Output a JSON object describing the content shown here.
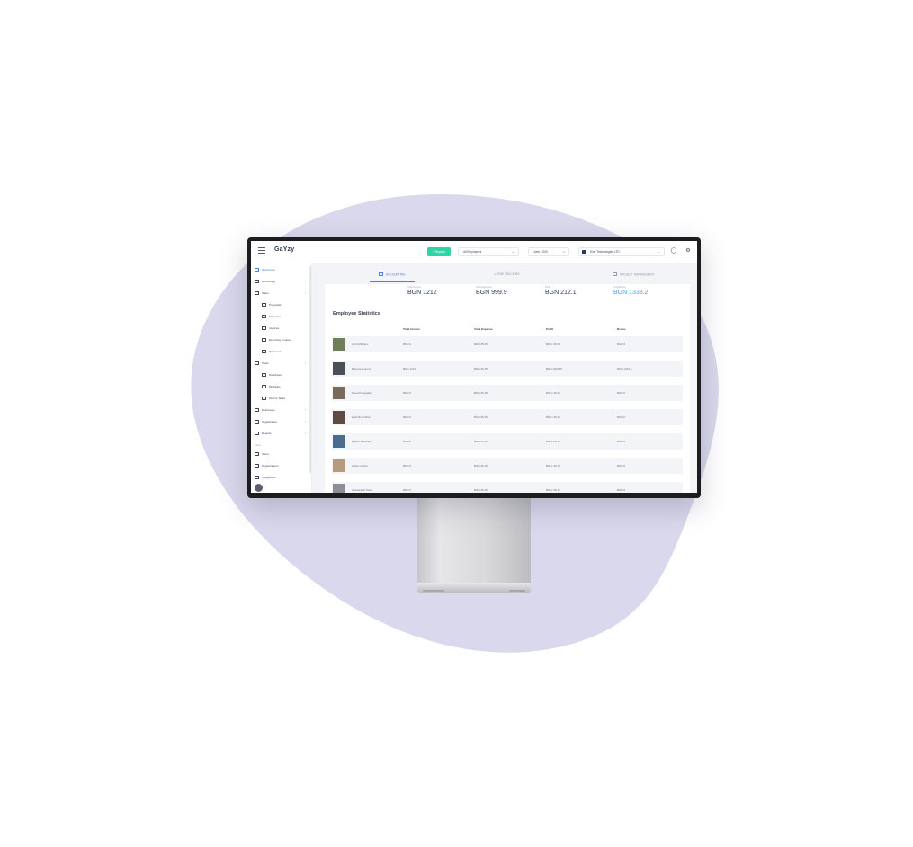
{
  "app": {
    "logo": "GaYzy"
  },
  "topbar": {
    "reports_label": "+ Reports",
    "employee_filter": "All Employees",
    "date_filter": "June, 2020",
    "company": "Ever Technologies LTD"
  },
  "sidebar": {
    "items": [
      {
        "label": "Dashboard",
        "active": true
      },
      {
        "label": "Accounting",
        "has_chevron": true
      },
      {
        "label": "Sales",
        "has_chevron": true
      },
      {
        "label": "Proposals",
        "sub": true
      },
      {
        "label": "Estimates",
        "sub": true
      },
      {
        "label": "Invoices",
        "sub": true
      },
      {
        "label": "Recurring Invoices",
        "sub": true
      },
      {
        "label": "Payments",
        "sub": true
      },
      {
        "label": "Tasks",
        "has_chevron": true
      },
      {
        "label": "Dashboard",
        "sub": true
      },
      {
        "label": "My Tasks",
        "sub": true
      },
      {
        "label": "Team's Tasks",
        "sub": true
      },
      {
        "label": "Employees",
        "has_chevron": true
      },
      {
        "label": "Organization",
        "has_chevron": true
      },
      {
        "label": "Reports",
        "has_chevron": true
      }
    ],
    "section_label": "Admin",
    "admin_items": [
      {
        "label": "Users"
      },
      {
        "label": "Organizations"
      },
      {
        "label": "Integrations"
      }
    ]
  },
  "tabs": [
    {
      "label": "ACCOUNTING",
      "active": true
    },
    {
      "label": "TIME TRACKING"
    },
    {
      "label": "PROJECT MANAGEMENT"
    }
  ],
  "kpis": [
    {
      "label": "Total Income",
      "value": "BGN 1212"
    },
    {
      "label": "Total Expenses",
      "value": "BGN 999.9"
    },
    {
      "label": "Profit",
      "value": "BGN 212.1"
    },
    {
      "label": "Total Bonus",
      "value": "BGN 1333.2",
      "accent": true
    }
  ],
  "stats": {
    "title": "Employee Statistics",
    "columns": [
      "Total Income",
      "Total Expense",
      "Profit",
      "Bonus"
    ],
    "rows": [
      {
        "name": "Alish Meklyov",
        "income": "BGN 0",
        "expense": "BGN 45.45",
        "profit": "BGN -45.45",
        "bonus": "BGN 0",
        "avatar_color": "#6f7d5a"
      },
      {
        "name": "Blagovest Gerov",
        "income": "BGN 1212",
        "expense": "BGN 45.45",
        "profit": "BGN 1166.55",
        "bonus": "BGN 1333.2",
        "avatar_color": "#4b4f57"
      },
      {
        "name": "Pavel Kokaydjiev",
        "income": "BGN 0",
        "expense": "BGN 45.45",
        "profit": "BGN -45.45",
        "bonus": "BGN 0",
        "avatar_color": "#7a6a5c"
      },
      {
        "name": "Emil Momchilov",
        "income": "BGN 0",
        "expense": "BGN 45.45",
        "profit": "BGN -45.45",
        "bonus": "BGN 0",
        "avatar_color": "#5d4a42"
      },
      {
        "name": "Boyan Stanchev",
        "income": "BGN 0",
        "expense": "BGN 45.45",
        "profit": "BGN -45.45",
        "bonus": "BGN 0",
        "avatar_color": "#4d6b8f"
      },
      {
        "name": "Hristo Hristov",
        "income": "BGN 0",
        "expense": "BGN 45.45",
        "profit": "BGN -45.45",
        "bonus": "BGN 0",
        "avatar_color": "#b59a7c"
      },
      {
        "name": "Aleksandar Tasev",
        "income": "BGN 0",
        "expense": "BGN 45.45",
        "profit": "BGN -45.45",
        "bonus": "BGN 0",
        "avatar_color": "#8c8f96"
      }
    ]
  },
  "colors": {
    "accent": "#4a7fe0",
    "reports_button": "#2ed3a6",
    "blob": "#d9d8ec"
  }
}
